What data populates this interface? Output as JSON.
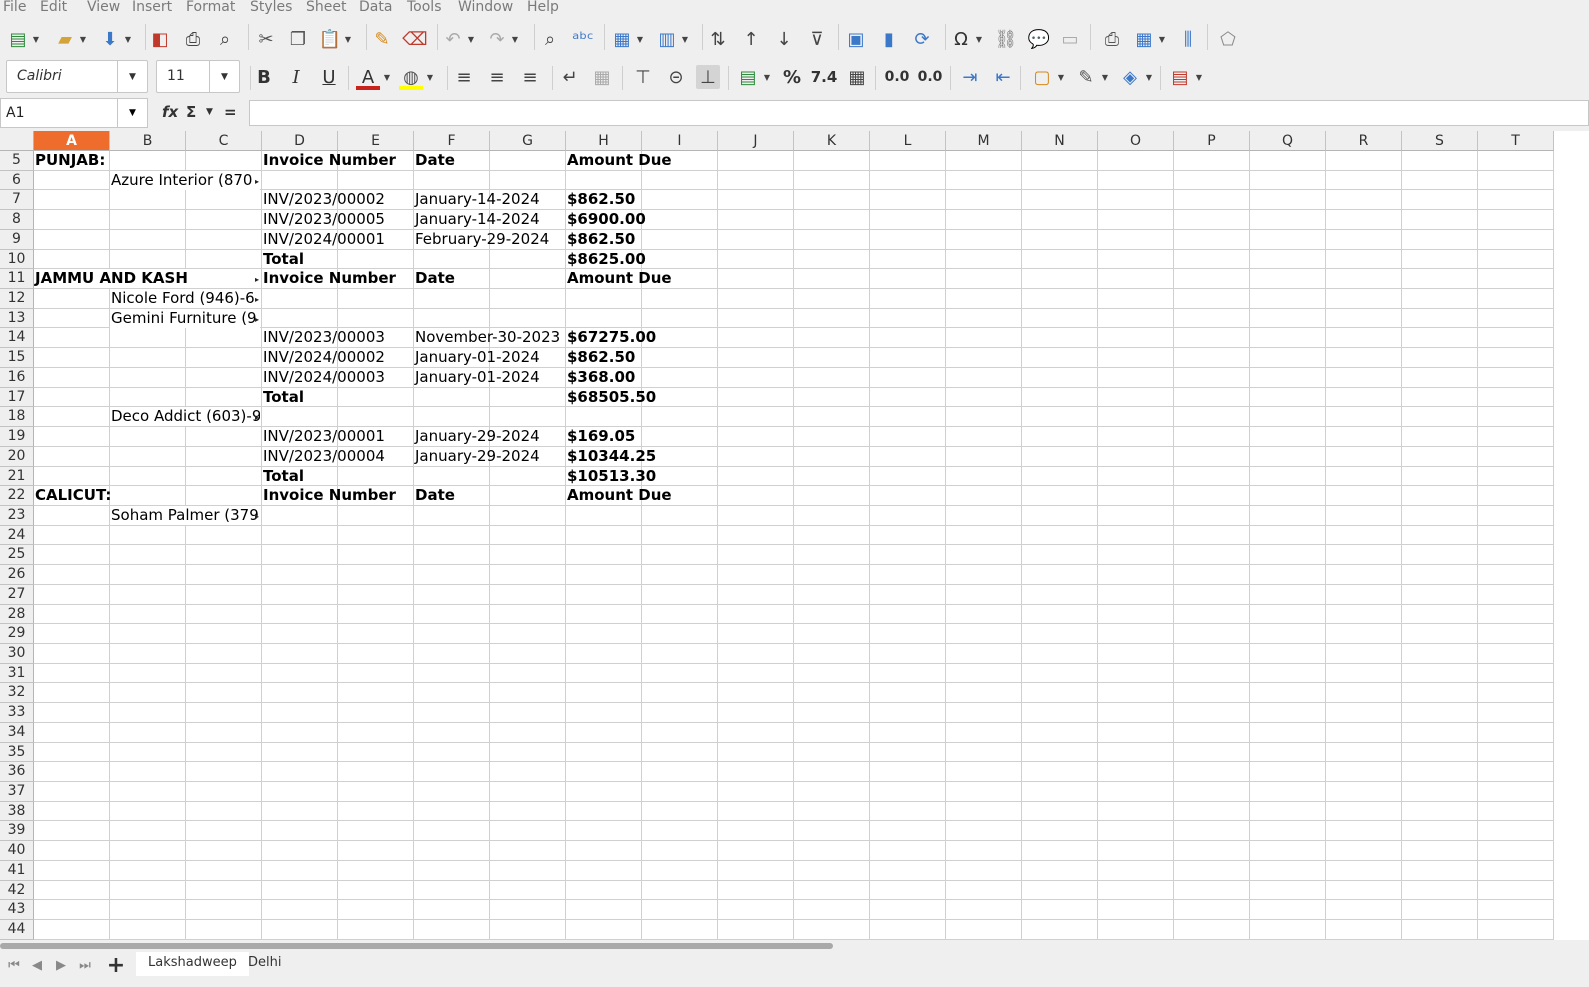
{
  "menubar": [
    "File",
    "Edit",
    "View",
    "Insert",
    "Format",
    "Styles",
    "Sheet",
    "Data",
    "Tools",
    "Window",
    "Help"
  ],
  "toolbar": {
    "font_name": "Calibri",
    "font_size": "11",
    "percent_label": "%",
    "number_label": "7.4",
    "add_decimal_label": "0.0",
    "delete_decimal_label": "0.0"
  },
  "formula_bar": {
    "cell_ref": "A1",
    "fx_label": "fx",
    "sum_label": "Σ",
    "equals_label": "=",
    "value": ""
  },
  "columns": [
    "A",
    "B",
    "C",
    "D",
    "E",
    "F",
    "G",
    "H",
    "I",
    "J",
    "K",
    "L",
    "M",
    "N",
    "O",
    "P",
    "Q",
    "R",
    "S",
    "T"
  ],
  "active_column": "A",
  "rows": [
    "5",
    "6",
    "7",
    "8",
    "9",
    "10",
    "11",
    "12",
    "13",
    "14",
    "15",
    "16",
    "17",
    "18",
    "19",
    "20",
    "21",
    "22",
    "23",
    "24",
    "25",
    "26",
    "27",
    "28",
    "29",
    "30",
    "31",
    "32",
    "33",
    "34",
    "35",
    "36",
    "37",
    "38",
    "39",
    "40",
    "41",
    "42",
    "43",
    "44"
  ],
  "cells": [
    {
      "row": "5",
      "col": "A",
      "text": "PUNJAB:",
      "bold": true
    },
    {
      "row": "5",
      "col": "D",
      "text": "Invoice Number",
      "bold": true
    },
    {
      "row": "5",
      "col": "F",
      "text": "Date",
      "bold": true
    },
    {
      "row": "5",
      "col": "H",
      "text": "Amount Due",
      "bold": true
    },
    {
      "row": "6",
      "col": "B",
      "text": "Azure Interior (870",
      "bold": false,
      "clipped": true
    },
    {
      "row": "7",
      "col": "D",
      "text": "INV/2023/00002",
      "bold": false
    },
    {
      "row": "7",
      "col": "F",
      "text": "January-14-2024",
      "bold": false
    },
    {
      "row": "7",
      "col": "H",
      "text": "$862.50",
      "bold": true
    },
    {
      "row": "8",
      "col": "D",
      "text": "INV/2023/00005",
      "bold": false
    },
    {
      "row": "8",
      "col": "F",
      "text": "January-14-2024",
      "bold": false
    },
    {
      "row": "8",
      "col": "H",
      "text": "$6900.00",
      "bold": true
    },
    {
      "row": "9",
      "col": "D",
      "text": "INV/2024/00001",
      "bold": false
    },
    {
      "row": "9",
      "col": "F",
      "text": "February-29-2024",
      "bold": false
    },
    {
      "row": "9",
      "col": "H",
      "text": "$862.50",
      "bold": true
    },
    {
      "row": "10",
      "col": "D",
      "text": "Total",
      "bold": true
    },
    {
      "row": "10",
      "col": "H",
      "text": "$8625.00",
      "bold": true
    },
    {
      "row": "11",
      "col": "A",
      "text": "JAMMU AND KASH",
      "bold": true,
      "clipped": true
    },
    {
      "row": "11",
      "col": "D",
      "text": "Invoice Number",
      "bold": true
    },
    {
      "row": "11",
      "col": "F",
      "text": "Date",
      "bold": true
    },
    {
      "row": "11",
      "col": "H",
      "text": "Amount Due",
      "bold": true
    },
    {
      "row": "12",
      "col": "B",
      "text": "Nicole Ford (946)-6",
      "bold": false,
      "clipped": true
    },
    {
      "row": "13",
      "col": "B",
      "text": "Gemini Furniture (9",
      "bold": false,
      "clipped": true
    },
    {
      "row": "14",
      "col": "D",
      "text": "INV/2023/00003",
      "bold": false
    },
    {
      "row": "14",
      "col": "F",
      "text": "November-30-2023",
      "bold": false
    },
    {
      "row": "14",
      "col": "H",
      "text": "$67275.00",
      "bold": true
    },
    {
      "row": "15",
      "col": "D",
      "text": "INV/2024/00002",
      "bold": false
    },
    {
      "row": "15",
      "col": "F",
      "text": "January-01-2024",
      "bold": false
    },
    {
      "row": "15",
      "col": "H",
      "text": "$862.50",
      "bold": true
    },
    {
      "row": "16",
      "col": "D",
      "text": "INV/2024/00003",
      "bold": false
    },
    {
      "row": "16",
      "col": "F",
      "text": "January-01-2024",
      "bold": false
    },
    {
      "row": "16",
      "col": "H",
      "text": "$368.00",
      "bold": true
    },
    {
      "row": "17",
      "col": "D",
      "text": "Total",
      "bold": true
    },
    {
      "row": "17",
      "col": "H",
      "text": "$68505.50",
      "bold": true
    },
    {
      "row": "18",
      "col": "B",
      "text": "Deco Addict (603)-9",
      "bold": false,
      "clipped": true
    },
    {
      "row": "19",
      "col": "D",
      "text": "INV/2023/00001",
      "bold": false
    },
    {
      "row": "19",
      "col": "F",
      "text": "January-29-2024",
      "bold": false
    },
    {
      "row": "19",
      "col": "H",
      "text": "$169.05",
      "bold": true
    },
    {
      "row": "20",
      "col": "D",
      "text": "INV/2023/00004",
      "bold": false
    },
    {
      "row": "20",
      "col": "F",
      "text": "January-29-2024",
      "bold": false
    },
    {
      "row": "20",
      "col": "H",
      "text": "$10344.25",
      "bold": true
    },
    {
      "row": "21",
      "col": "D",
      "text": "Total",
      "bold": true
    },
    {
      "row": "21",
      "col": "H",
      "text": "$10513.30",
      "bold": true
    },
    {
      "row": "22",
      "col": "A",
      "text": "CALICUT:",
      "bold": true
    },
    {
      "row": "22",
      "col": "D",
      "text": "Invoice Number",
      "bold": true
    },
    {
      "row": "22",
      "col": "F",
      "text": "Date",
      "bold": true
    },
    {
      "row": "22",
      "col": "H",
      "text": "Amount Due",
      "bold": true
    },
    {
      "row": "23",
      "col": "B",
      "text": "Soham Palmer (379",
      "bold": false,
      "clipped": true
    }
  ],
  "sheet_tabs": [
    "Lakshadweep",
    "Delhi"
  ],
  "active_sheet": "Lakshadweep",
  "colors": {
    "active_header": "#ef6d2c",
    "font_color_bar": "#c9211e",
    "highlight_bar": "#ffff00"
  }
}
